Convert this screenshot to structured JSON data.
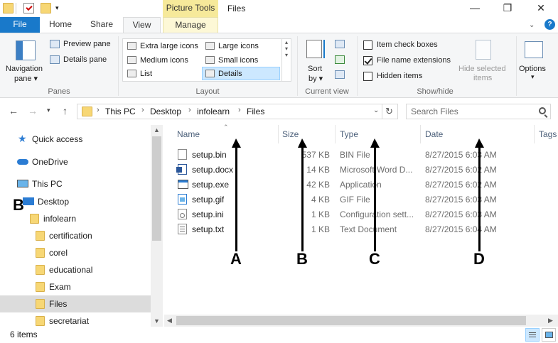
{
  "titlebar": {
    "context_tab_label": "Picture Tools",
    "title": "Files",
    "minimize": "—",
    "maximize": "❐",
    "close": "✕"
  },
  "tabs": {
    "file": "File",
    "home": "Home",
    "share": "Share",
    "view": "View",
    "manage": "Manage",
    "help": "?"
  },
  "ribbon": {
    "panes": {
      "group_label": "Panes",
      "navigation_pane": "Navigation",
      "navigation_pane_2": "pane",
      "preview_pane": "Preview pane",
      "details_pane": "Details pane"
    },
    "layout": {
      "group_label": "Layout",
      "items": [
        "Extra large icons",
        "Large icons",
        "Medium icons",
        "Small icons",
        "List",
        "Details"
      ],
      "selected": "Details"
    },
    "current_view": {
      "group_label": "Current view",
      "sort_by": "Sort",
      "sort_by_2": "by"
    },
    "show_hide": {
      "group_label": "Show/hide",
      "item_check_boxes": "Item check boxes",
      "file_name_extensions": "File name extensions",
      "hidden_items": "Hidden items",
      "hide_selected_1": "Hide selected",
      "hide_selected_2": "items",
      "item_check_boxes_checked": false,
      "file_name_extensions_checked": true,
      "hidden_items_checked": false
    },
    "options": "Options"
  },
  "address": {
    "crumbs": [
      "This PC",
      "Desktop",
      "infolearn",
      "Files"
    ],
    "search_placeholder": "Search Files"
  },
  "navpane": {
    "items": [
      {
        "label": "Quick access",
        "icon": "star-icon"
      },
      {
        "label": "OneDrive",
        "icon": "cloud-icon"
      },
      {
        "label": "This PC",
        "icon": "computer-icon"
      },
      {
        "label": "Desktop",
        "icon": "desktop-icon"
      },
      {
        "label": "infolearn",
        "icon": "folder-icon"
      },
      {
        "label": "certification",
        "icon": "folder-icon"
      },
      {
        "label": "corel",
        "icon": "folder-icon"
      },
      {
        "label": "educational",
        "icon": "folder-icon"
      },
      {
        "label": "Exam",
        "icon": "folder-icon"
      },
      {
        "label": "Files",
        "icon": "folder-icon"
      },
      {
        "label": "secretariat",
        "icon": "folder-icon"
      }
    ],
    "selected": "Files"
  },
  "filelist": {
    "columns": [
      "Name",
      "Size",
      "Type",
      "Date",
      "Tags"
    ],
    "files": [
      {
        "name": "setup.bin",
        "size": "537 KB",
        "type": "BIN File",
        "date": "8/27/2015 6:03 AM",
        "icon": "file-icon"
      },
      {
        "name": "setup.docx",
        "size": "14 KB",
        "type": "Microsoft Word D...",
        "date": "8/27/2015 6:02 AM",
        "icon": "word-doc-icon"
      },
      {
        "name": "setup.exe",
        "size": "42 KB",
        "type": "Application",
        "date": "8/27/2015 6:02 AM",
        "icon": "application-icon"
      },
      {
        "name": "setup.gif",
        "size": "4 KB",
        "type": "GIF File",
        "date": "8/27/2015 6:03 AM",
        "icon": "image-icon"
      },
      {
        "name": "setup.ini",
        "size": "1 KB",
        "type": "Configuration sett...",
        "date": "8/27/2015 6:03 AM",
        "icon": "config-file-icon"
      },
      {
        "name": "setup.txt",
        "size": "1 KB",
        "type": "Text Document",
        "date": "8/27/2015 6:04 AM",
        "icon": "text-file-icon"
      }
    ]
  },
  "status": {
    "item_count": "6 items"
  },
  "annotations": {
    "a": "A",
    "b": "B",
    "c": "C",
    "d": "D",
    "b_nav": "B"
  },
  "colors": {
    "file_tab": "#1979ca",
    "context_tab": "#f6e99a",
    "selection": "#cce8ff"
  }
}
